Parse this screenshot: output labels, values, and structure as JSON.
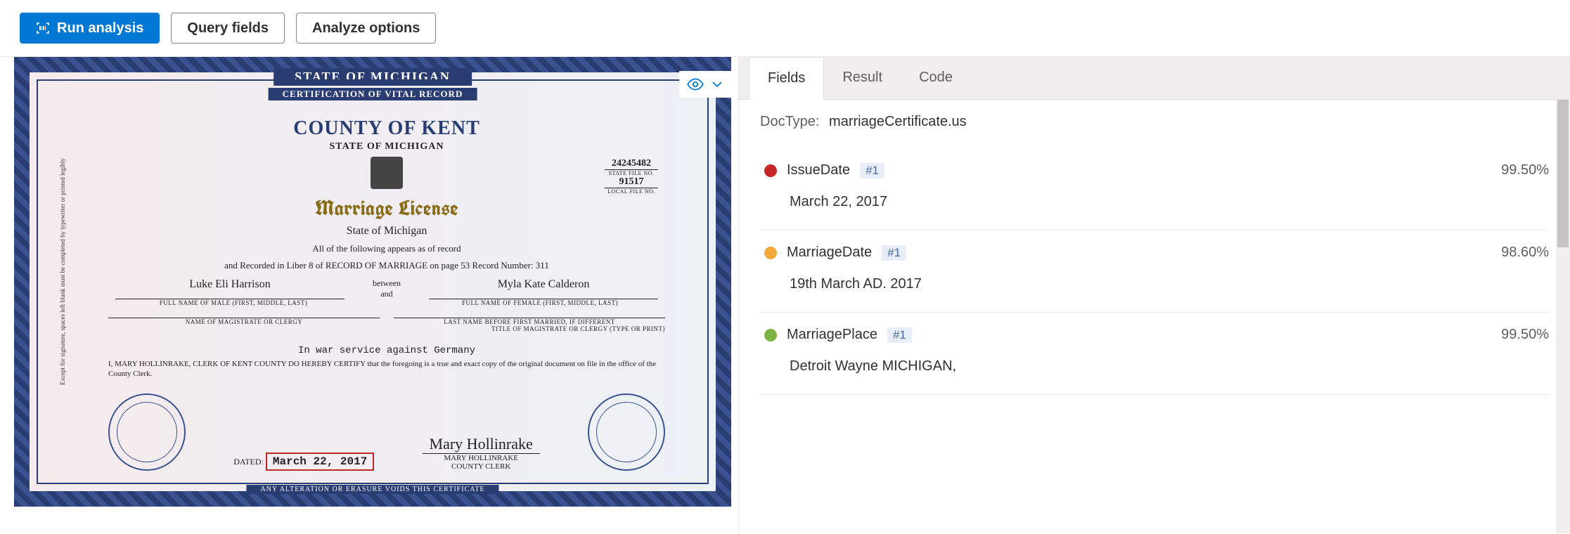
{
  "toolbar": {
    "run_label": "Run analysis",
    "query_label": "Query fields",
    "analyze_label": "Analyze options"
  },
  "certificate": {
    "ribbon1": "STATE OF MICHIGAN",
    "ribbon2": "CERTIFICATION OF VITAL RECORD",
    "ribbon3": "ANY ALTERATION OR ERASURE VOIDS THIS CERTIFICATE",
    "county_title": "COUNTY OF KENT",
    "state_sub": "STATE OF MICHIGAN",
    "doc_title": "Marriage License",
    "state_line": "State of Michigan",
    "appears_line": "All of the following appears as of record",
    "recorded_line": "and Recorded in Liber  8  of RECORD OF MARRIAGE on page  53   Record Number:  311",
    "male_name": "Luke Eli Harrison",
    "male_label": "FULL NAME OF MALE (FIRST, MIDDLE, LAST)",
    "between": "between",
    "and": "and",
    "female_name": "Myla Kate Calderon",
    "female_label": "FULL NAME OF FEMALE (FIRST, MIDDLE, LAST)",
    "state_file_no": "24245482",
    "state_file_lab": "STATE FILE NO.",
    "local_file_no": "91517",
    "local_file_lab": "LOCAL FILE NO.",
    "left_note": "Except for signature, spaces left blank must be completed by typewriter or printed legibly",
    "magistrate_lab": "NAME OF MAGISTRATE OR CLERGY",
    "lastname_lab": "LAST NAME BEFORE FIRST MARRIED, IF DIFFERENT",
    "title_mag_lab": "TITLE OF MAGISTRATE OR CLERGY (TYPE OR PRINT)",
    "service_line": "In war service against Germany",
    "certify_line": "I, MARY HOLLINRAKE, CLERK OF KENT COUNTY DO HEREBY CERTIFY that the foregoing is a true and exact copy of the original document on file in the office of the County Clerk.",
    "dated_lab": "DATED:",
    "dated_val": "March 22, 2017",
    "clerk_sig": "Mary Hollinrake",
    "clerk_name": "MARY HOLLINRAKE",
    "clerk_title": "COUNTY CLERK"
  },
  "tabs": [
    "Fields",
    "Result",
    "Code"
  ],
  "doctype_label": "DocType:",
  "doctype_value": "marriageCertificate.us",
  "fields": [
    {
      "color": "#c62828",
      "name": "IssueDate",
      "badge": "#1",
      "conf": "99.50%",
      "value": "March 22, 2017"
    },
    {
      "color": "#f2a93b",
      "name": "MarriageDate",
      "badge": "#1",
      "conf": "98.60%",
      "value": "19th March AD. 2017"
    },
    {
      "color": "#7cb342",
      "name": "MarriagePlace",
      "badge": "#1",
      "conf": "99.50%",
      "value": "Detroit Wayne MICHIGAN,"
    }
  ]
}
